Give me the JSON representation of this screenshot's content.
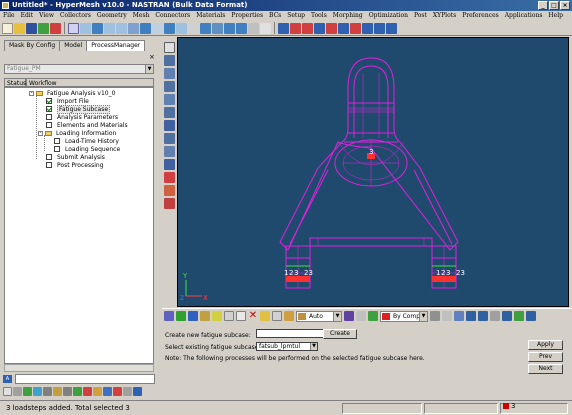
{
  "window": {
    "title": "Untitled* - HyperMesh v10.0 - NASTRAN (Bulk Data Format)",
    "controls": [
      "_",
      "□",
      "×"
    ]
  },
  "menu": [
    "File",
    "Edit",
    "View",
    "Collectors",
    "Geometry",
    "Mesh",
    "Connectors",
    "Materials",
    "Properties",
    "BCs",
    "Setup",
    "Tools",
    "Morphing",
    "Optimization",
    "Post",
    "XYPlots",
    "Preferences",
    "Applications",
    "Help"
  ],
  "left_panel": {
    "tabs": [
      "Mask By Config",
      "Model",
      "ProcessManager"
    ],
    "active_tab": "ProcessManager",
    "close": "×",
    "template_select": "Fatigue_PM",
    "workflow_headers": [
      "Status",
      "Workflow"
    ],
    "tree": {
      "root": "Fatigue Analysis v10_0",
      "import_file": "Import File",
      "fatigue_subcase": "Fatigue Subcase",
      "analysis_parameters": "Analysis Parameters",
      "elements_and_materials": "Elements and Materials",
      "loading_information": "Loading Information",
      "load_time_history": "Load-Time History",
      "loading_sequence": "Loading Sequence",
      "submit_analysis": "Submit Analysis",
      "post_processing": "Post Processing"
    },
    "command_value": ""
  },
  "viewport": {
    "background": "#1f4a6e",
    "mesh_color": "#e020e0",
    "node_labels": {
      "top_center": "3",
      "left_1": "1",
      "left_2": "2",
      "left_3": "3",
      "left_23": "23",
      "right_1": "1",
      "right_2": "2",
      "right_3": "3",
      "right_23": "23"
    },
    "axis": {
      "x": "X",
      "y": "Y",
      "z": "Z"
    }
  },
  "bottom_toolbar": {
    "mode_select": "Auto",
    "color_select": "By Comp"
  },
  "form": {
    "create_label": "Create new fatigue subcase:",
    "create_value": "",
    "create_button": "Create",
    "select_label": "Select existing fatigue subcase:",
    "select_value": "fatsub_lpmtul",
    "note": "Note: The following processes will be performed on the selected fatigue subcase here.",
    "apply_button": "Apply",
    "prev_button": "Prev",
    "next_button": "Next"
  },
  "status": {
    "message": "3 loadsteps added. Total selected 3",
    "count": "3"
  }
}
